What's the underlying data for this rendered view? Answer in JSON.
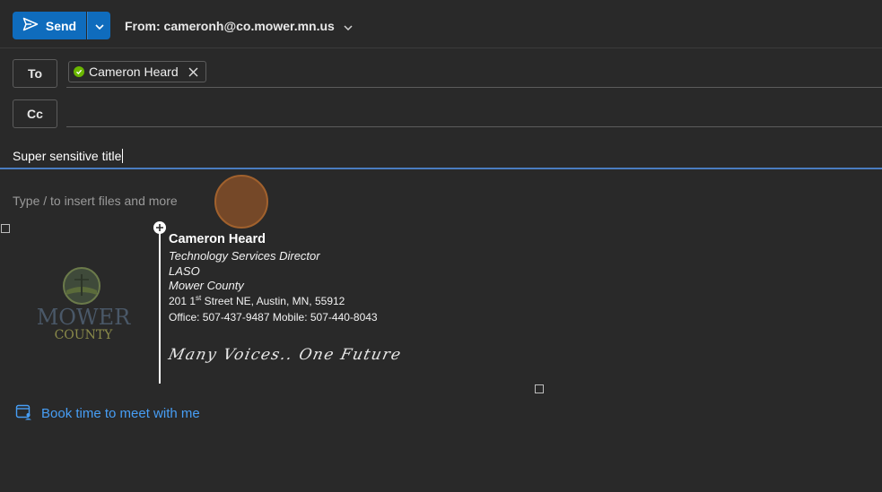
{
  "toolbar": {
    "send_label": "Send",
    "from_label": "From: cameronh@co.mower.mn.us"
  },
  "recipients": {
    "to_label": "To",
    "cc_label": "Cc",
    "to_chips": [
      {
        "name": "Cameron Heard",
        "status": "available"
      }
    ]
  },
  "subject": {
    "value": "Super sensitive title"
  },
  "body": {
    "placeholder": "Type / to insert files and more",
    "signature": {
      "name": "Cameron Heard",
      "title": "Technology Services Director",
      "department": "LASO",
      "organization": "Mower County",
      "address_number": "201 1",
      "address_ordinal": "st",
      "address_rest": " Street NE, Austin, MN, 55912",
      "phone": "Office: 507-437-9487 Mobile: 507-440-8043",
      "motto": "Many Voices.. One Future",
      "logo_line1": "MOWER",
      "logo_line2": "COUNTY"
    },
    "book_link": "Book time to meet with me"
  },
  "colors": {
    "accent": "#0f6cbd",
    "link": "#479ef5",
    "presence_available": "#6bb700",
    "background": "#292929"
  }
}
